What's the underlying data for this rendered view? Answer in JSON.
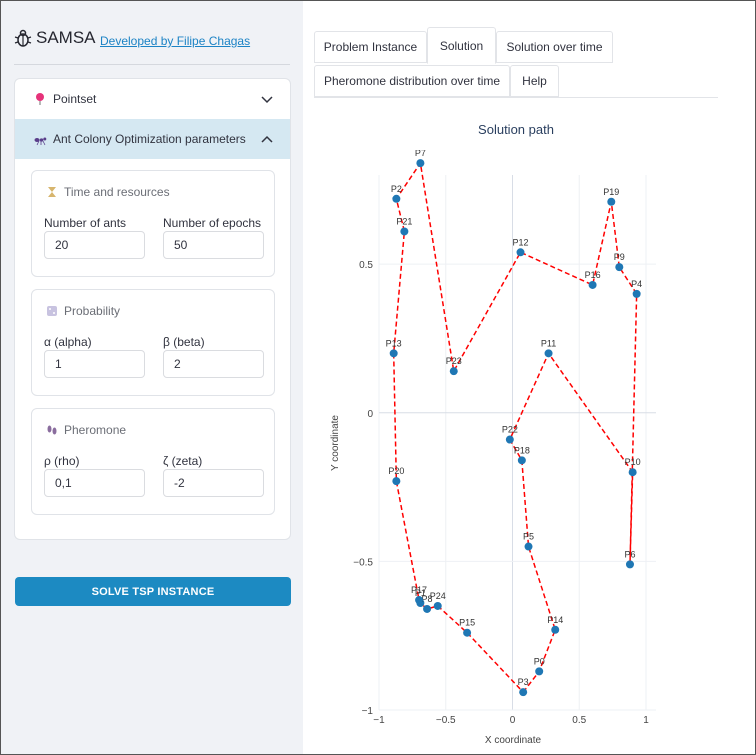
{
  "app": {
    "title": "SAMSA",
    "author_link": "Developed by Filipe Chagas"
  },
  "sidebar": {
    "pointset_label": "Pointset",
    "aco_label": "Ant Colony Optimization parameters",
    "time_resources": {
      "caption": "Time and resources",
      "ants_label": "Number of ants",
      "ants_value": "20",
      "epochs_label": "Number of epochs",
      "epochs_value": "50"
    },
    "probability": {
      "caption": "Probability",
      "alpha_label": "α (alpha)",
      "alpha_value": "1",
      "beta_label": "β (beta)",
      "beta_value": "2"
    },
    "pheromone": {
      "caption": "Pheromone",
      "rho_label": "ρ (rho)",
      "rho_value": "0,1",
      "zeta_label": "ζ (zeta)",
      "zeta_value": "-2"
    },
    "solve_label": "SOLVE TSP INSTANCE"
  },
  "tabs": [
    {
      "label": "Problem Instance",
      "active": false
    },
    {
      "label": "Solution",
      "active": true
    },
    {
      "label": "Solution over time",
      "active": false
    },
    {
      "label": "Pheromone distribution over time",
      "active": false
    },
    {
      "label": "Help",
      "active": false
    }
  ],
  "colors": {
    "marker": "#1f77b4",
    "path": "#ff0000",
    "button": "#1c8ac2",
    "selected_row": "#d5e8f2"
  },
  "chart_data": {
    "type": "scatter",
    "title": "Solution path",
    "xlabel": "X coordinate",
    "ylabel": "Y coordinate",
    "xlim": [
      -1,
      1
    ],
    "ylim": [
      -1,
      0.8
    ],
    "x_ticks": [
      "−1",
      "−0.5",
      "0",
      "0.5",
      "1"
    ],
    "y_ticks": [
      "−1",
      "−0.5",
      "0",
      "0.5"
    ],
    "points": [
      {
        "name": "P0",
        "x": 0.2,
        "y": -0.87
      },
      {
        "name": "P1",
        "x": -0.69,
        "y": -0.64
      },
      {
        "name": "P2",
        "x": -0.87,
        "y": 0.72
      },
      {
        "name": "P3",
        "x": 0.08,
        "y": -0.94
      },
      {
        "name": "P4",
        "x": 0.93,
        "y": 0.4
      },
      {
        "name": "P5",
        "x": 0.12,
        "y": -0.45
      },
      {
        "name": "P6",
        "x": 0.88,
        "y": -0.51
      },
      {
        "name": "P7",
        "x": -0.69,
        "y": 0.84
      },
      {
        "name": "P8",
        "x": -0.64,
        "y": -0.66
      },
      {
        "name": "P9",
        "x": 0.8,
        "y": 0.49
      },
      {
        "name": "P10",
        "x": 0.9,
        "y": -0.2
      },
      {
        "name": "P11",
        "x": 0.27,
        "y": 0.2
      },
      {
        "name": "P12",
        "x": 0.06,
        "y": 0.54
      },
      {
        "name": "P13",
        "x": -0.89,
        "y": 0.2
      },
      {
        "name": "P14",
        "x": 0.32,
        "y": -0.73
      },
      {
        "name": "P15",
        "x": -0.34,
        "y": -0.74
      },
      {
        "name": "P16",
        "x": 0.6,
        "y": 0.43
      },
      {
        "name": "P17",
        "x": -0.7,
        "y": -0.63
      },
      {
        "name": "P18",
        "x": 0.07,
        "y": -0.16
      },
      {
        "name": "P19",
        "x": 0.74,
        "y": 0.71
      },
      {
        "name": "P20",
        "x": -0.87,
        "y": -0.23
      },
      {
        "name": "P21",
        "x": -0.81,
        "y": 0.61
      },
      {
        "name": "P22",
        "x": -0.02,
        "y": -0.09
      },
      {
        "name": "P23",
        "x": -0.44,
        "y": 0.14
      },
      {
        "name": "P24",
        "x": -0.56,
        "y": -0.65
      }
    ],
    "tour": [
      "P3",
      "P0",
      "P14",
      "P5",
      "P18",
      "P22",
      "P11",
      "P10",
      "P6",
      "P4",
      "P9",
      "P19",
      "P16",
      "P12",
      "P23",
      "P7",
      "P2",
      "P21",
      "P13",
      "P20",
      "P17",
      "P1",
      "P8",
      "P24",
      "P15",
      "P3"
    ]
  }
}
